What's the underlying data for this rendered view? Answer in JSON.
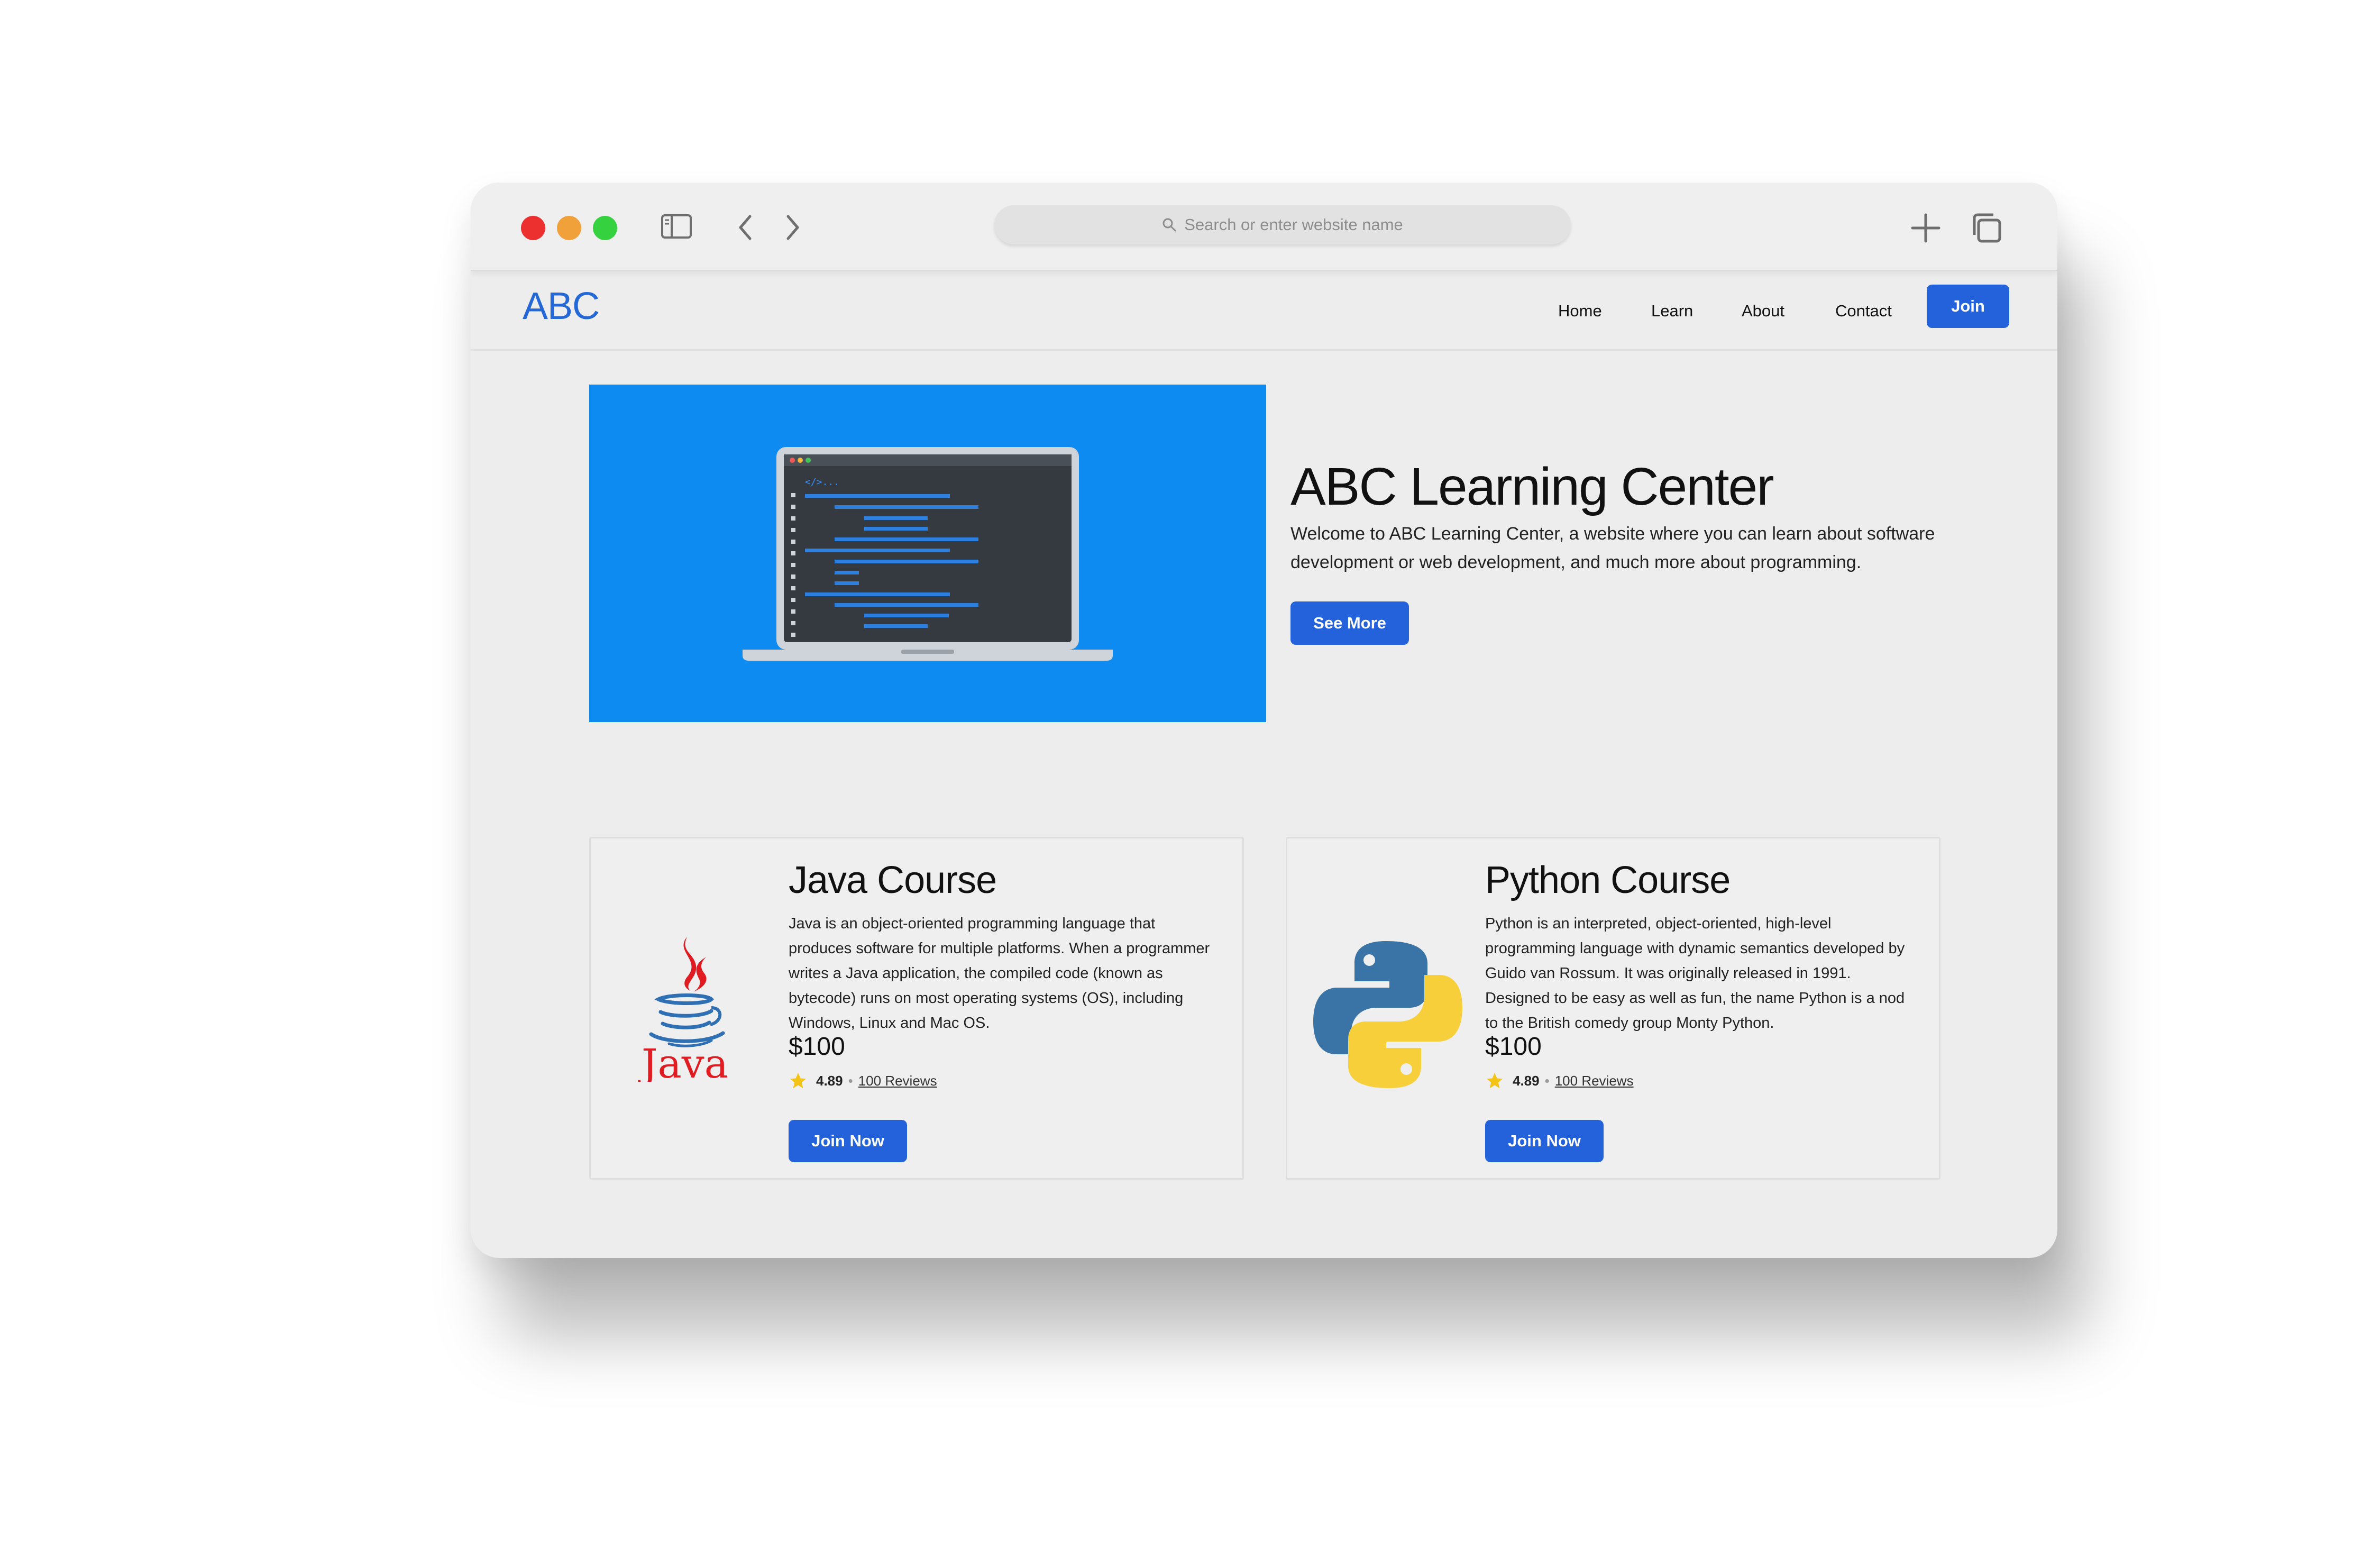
{
  "browser": {
    "url_placeholder": "Search or enter website name"
  },
  "site": {
    "logo": "ABC",
    "nav": {
      "home": "Home",
      "learn": "Learn",
      "about": "About",
      "contact": "Contact",
      "join": "Join"
    }
  },
  "hero": {
    "code_tag": "</>...",
    "title": "ABC Learning Center",
    "description": "Welcome to ABC Learning Center, a website where you can learn about software development or web development, and much more about programming.",
    "button": "See More"
  },
  "courses": [
    {
      "title": "Java Course",
      "logo_text": "Java",
      "description": "Java is an object-oriented programming language that produces software for multiple platforms. When a programmer writes a Java application, the compiled code (known as bytecode) runs on most operating systems (OS), including Windows, Linux and Mac OS.",
      "price": "$100",
      "rating": "4.89",
      "reviews": "100 Reviews",
      "button": "Join Now"
    },
    {
      "title": "Python Course",
      "description": "Python is an interpreted, object-oriented, high-level programming language with dynamic semantics developed by Guido van Rossum. It was originally released in 1991. Designed to be easy as well as fun, the name Python is a nod to the British comedy group Monty Python.",
      "price": "$100",
      "rating": "4.89",
      "reviews": "100 Reviews",
      "button": "Join Now"
    }
  ],
  "colors": {
    "accent": "#2462dc",
    "hero_bg": "#0d8bf0",
    "java_red": "#e11b22",
    "java_blue": "#2f6fb3",
    "python_blue": "#3a73a6",
    "python_yellow": "#f6cf3a",
    "star": "#f3c316"
  },
  "icons": {
    "window_controls": [
      "close-dot",
      "minimize-dot",
      "zoom-dot"
    ],
    "toolbar": [
      "sidebar-icon",
      "back-chevron-icon",
      "forward-chevron-icon",
      "search-icon",
      "new-tab-plus-icon",
      "tabs-overview-icon"
    ],
    "rating": "star-icon"
  }
}
